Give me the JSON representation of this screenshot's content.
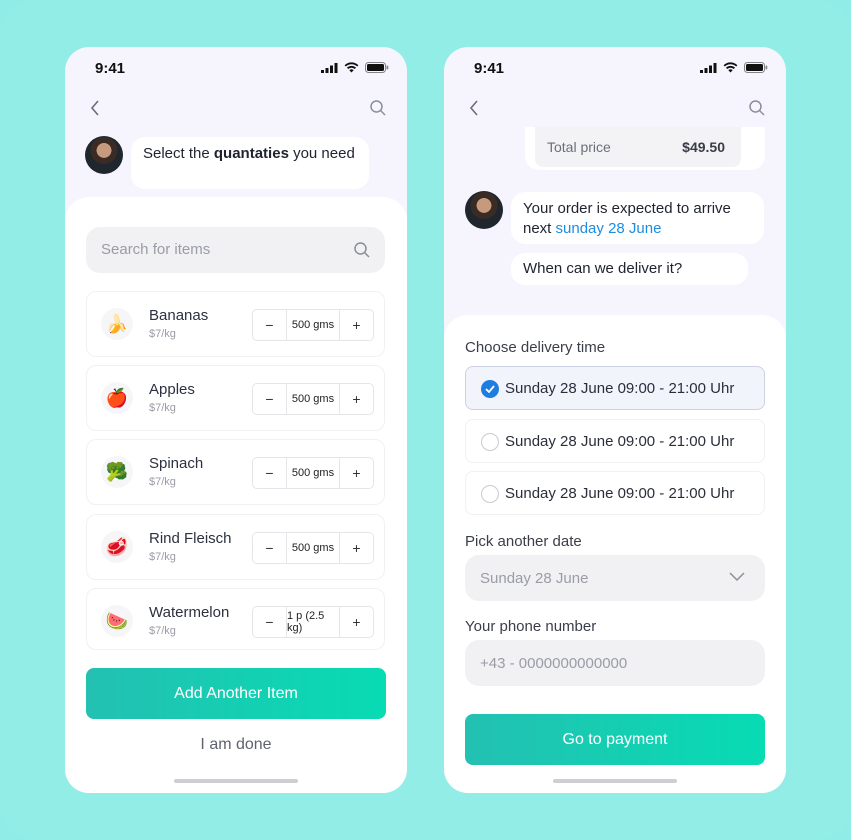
{
  "status": {
    "time": "9:41"
  },
  "left": {
    "bot_message_pre": "Select the ",
    "bot_message_bold": "quantaties",
    "bot_message_post": " you need",
    "search_placeholder": "Search for items",
    "items": [
      {
        "name": "Bananas",
        "price": "$7/kg",
        "qty": "500 gms",
        "icon": "banana-icon"
      },
      {
        "name": "Apples",
        "price": "$7/kg",
        "qty": "500 gms",
        "icon": "apple-icon"
      },
      {
        "name": "Spinach",
        "price": "$7/kg",
        "qty": "500 gms",
        "icon": "spinach-icon"
      },
      {
        "name": "Rind Fleisch",
        "price": "$7/kg",
        "qty": "500 gms",
        "icon": "meat-icon"
      },
      {
        "name": "Watermelon",
        "price": "$7/kg",
        "qty": "1 p (2.5 kg)",
        "icon": "watermelon-icon"
      }
    ],
    "minus": "−",
    "plus": "+",
    "add_button": "Add Another Item",
    "done_button": "I am done"
  },
  "right": {
    "total_label": "Total price",
    "total_value": "$49.50",
    "bot_message_pre": "Your order is expected to arrive next ",
    "bot_message_link": "sunday 28 June",
    "bot_question": "When can we deliver it?",
    "choose_label": "Choose delivery time",
    "slots": [
      {
        "label": "Sunday 28 June 09:00 - 21:00 Uhr",
        "selected": true
      },
      {
        "label": "Sunday 28 June 09:00 - 21:00 Uhr",
        "selected": false
      },
      {
        "label": "Sunday 28 June 09:00 - 21:00 Uhr",
        "selected": false
      }
    ],
    "date_label": "Pick another date",
    "date_value": "Sunday 28 June",
    "phone_label": "Your phone number",
    "phone_placeholder": "+43 - 0000000000000",
    "pay_button": "Go to payment"
  },
  "colors": {
    "accent": "#1d8de0",
    "button_start": "#24c0b2",
    "button_end": "#07dcb3",
    "background": "#91ede6"
  }
}
